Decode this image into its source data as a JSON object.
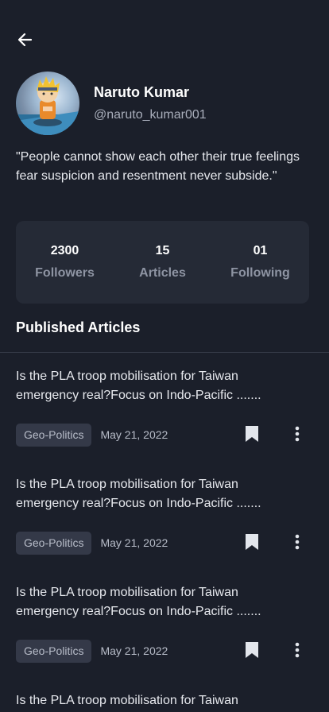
{
  "header": {
    "back_icon": "arrow-left-icon"
  },
  "profile": {
    "name": "Naruto Kumar",
    "handle": "@naruto_kumar001",
    "bio": "\"People cannot show each other their true feelings fear suspicion and resentment never subside.\""
  },
  "stats": [
    {
      "value": "2300",
      "label": "Followers"
    },
    {
      "value": "15",
      "label": "Articles"
    },
    {
      "value": "01",
      "label": "Following"
    }
  ],
  "section_title": "Published Articles",
  "articles": [
    {
      "title": "Is the PLA troop mobilisation for Taiwan emergency real?Focus on Indo-Pacific .......",
      "tag": "Geo-Politics",
      "date": "May 21, 2022"
    },
    {
      "title": "Is the PLA troop mobilisation for Taiwan emergency real?Focus on Indo-Pacific .......",
      "tag": "Geo-Politics",
      "date": "May 21, 2022"
    },
    {
      "title": "Is the PLA troop mobilisation for Taiwan emergency real?Focus on Indo-Pacific .......",
      "tag": "Geo-Politics",
      "date": "May 21, 2022"
    },
    {
      "title": "Is the PLA troop mobilisation for Taiwan",
      "tag": "",
      "date": ""
    }
  ],
  "colors": {
    "background": "#1b1f2a",
    "card": "#252a36",
    "tag_bg": "#343948",
    "muted": "#8e94a3"
  }
}
